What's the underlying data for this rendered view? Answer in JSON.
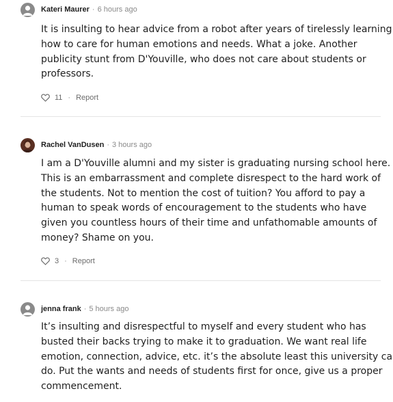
{
  "comments": [
    {
      "author": "Kateri Maurer",
      "separator": "·",
      "time": "6 hours ago",
      "avatar_icon": "user-silhouette-icon",
      "body_lines": [
        "It is insulting to hear advice from a robot after years of tirelessly learning",
        "how to care for human emotions and needs. What a joke. Another",
        "publicity stunt from D'Youville, who does not care about students or",
        "professors."
      ],
      "likes": "11",
      "action_separator": "·",
      "report_label": "Report"
    },
    {
      "author": "Rachel VanDusen",
      "separator": "·",
      "time": "3 hours ago",
      "avatar_icon": "profile-photo",
      "body_lines": [
        "I am a D'Youville alumni and my sister is graduating nursing school here.",
        "This is an embarrassment and complete disrespect to the hard work of",
        "the students. Not to mention the cost of tuition? You afford to pay a",
        "human to speak words of encouragement to the students who have",
        "given you countless hours of their time and unfathomable amounts of",
        "money? Shame on you."
      ],
      "likes": "3",
      "action_separator": "·",
      "report_label": "Report"
    },
    {
      "author": "jenna frank",
      "separator": "·",
      "time": "5 hours ago",
      "avatar_icon": "user-silhouette-icon",
      "body_lines": [
        "It’s insulting and disrespectful to myself and every student who has",
        "busted their backs trying to make it to graduation. We want real life",
        "emotion, connection, advice, etc. it’s the absolute least this university can",
        "do. Put the wants and needs of students first for once, give us a proper",
        "commencement."
      ]
    }
  ],
  "icons": {
    "like": "heart-outline-icon",
    "avatar_default": "user-silhouette-icon"
  },
  "colors": {
    "text": "#1f1f1f",
    "meta": "#8a8a8a",
    "divider": "#e4e4e4",
    "avatar_bg": "#8a8a8a"
  }
}
